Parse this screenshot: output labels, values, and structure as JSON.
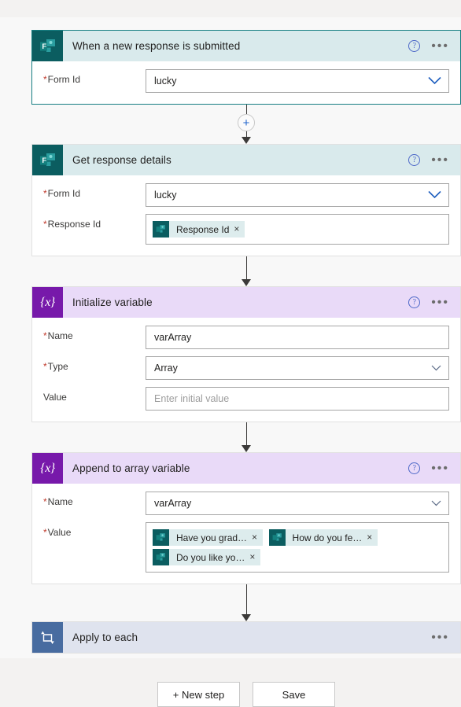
{
  "canvas": {
    "background_color": "#f8f8f8",
    "page_background_color": "#f3f2f1"
  },
  "colors": {
    "forms_icon": "#0b5d60",
    "forms_header": "#d9eaec",
    "variable_icon": "#7719aa",
    "variable_header": "#e9daf8",
    "loop_icon": "#486ca0",
    "loop_header": "#dfe3ee",
    "selected_border": "#167e82",
    "required_asterisk": "#c0392b",
    "link_blue": "#4d68c8",
    "token_chip": "#ddeced"
  },
  "steps": [
    {
      "id": "trigger",
      "title": "When a new response is submitted",
      "icon": "microsoft-forms-icon",
      "theme": "forms",
      "selected": true,
      "help_label": "?",
      "menu_label": "•••",
      "fields": [
        {
          "label": "Form Id",
          "required": true,
          "type": "dropdown",
          "value": "lucky",
          "placeholder": "",
          "chevron": "chevron-down-icon",
          "chevron_style": "blue"
        }
      ]
    },
    {
      "id": "get-response-details",
      "title": "Get response details",
      "icon": "microsoft-forms-icon",
      "theme": "forms",
      "selected": false,
      "help_label": "?",
      "menu_label": "•••",
      "fields": [
        {
          "label": "Form Id",
          "required": true,
          "type": "dropdown",
          "value": "lucky",
          "placeholder": "",
          "chevron": "chevron-down-icon",
          "chevron_style": "blue"
        },
        {
          "label": "Response Id",
          "required": true,
          "type": "tokens",
          "tokens": [
            {
              "text": "Response Id",
              "icon": "microsoft-forms-icon",
              "remove_label": "×"
            }
          ]
        }
      ]
    },
    {
      "id": "initialize-variable",
      "title": "Initialize variable",
      "icon": "variable-braces-icon",
      "theme": "varia",
      "selected": false,
      "help_label": "?",
      "menu_label": "•••",
      "fields": [
        {
          "label": "Name",
          "required": true,
          "type": "text",
          "value": "varArray",
          "placeholder": ""
        },
        {
          "label": "Type",
          "required": true,
          "type": "dropdown",
          "value": "Array",
          "placeholder": "",
          "chevron": "chevron-down-icon",
          "chevron_style": "gray"
        },
        {
          "label": "Value",
          "required": false,
          "type": "text",
          "value": "",
          "placeholder": "Enter initial value"
        }
      ]
    },
    {
      "id": "append-to-array-variable",
      "title": "Append to array variable",
      "icon": "variable-braces-icon",
      "theme": "varia",
      "selected": false,
      "help_label": "?",
      "menu_label": "•••",
      "fields": [
        {
          "label": "Name",
          "required": true,
          "type": "dropdown",
          "value": "varArray",
          "placeholder": "",
          "chevron": "chevron-down-icon",
          "chevron_style": "gray"
        },
        {
          "label": "Value",
          "required": true,
          "type": "tokens",
          "tokens": [
            {
              "text": "Have you grad…",
              "icon": "microsoft-forms-icon",
              "remove_label": "×"
            },
            {
              "text": "How do you fe…",
              "icon": "microsoft-forms-icon",
              "remove_label": "×"
            },
            {
              "text": "Do you like yo…",
              "icon": "microsoft-forms-icon",
              "remove_label": "×"
            }
          ]
        }
      ]
    },
    {
      "id": "apply-to-each",
      "title": "Apply to each",
      "icon": "loop-foreach-icon",
      "theme": "loop",
      "selected": false,
      "collapsed": true,
      "help_label": "",
      "menu_label": "•••",
      "fields": []
    }
  ],
  "connectors": [
    {
      "after": "trigger",
      "has_plus_button": true,
      "plus_label": "+"
    },
    {
      "after": "get-response-details",
      "has_plus_button": false
    },
    {
      "after": "initialize-variable",
      "has_plus_button": false
    },
    {
      "after": "append-to-array-variable",
      "has_plus_button": false
    }
  ],
  "footer": {
    "new_step_label": "+ New step",
    "save_label": "Save"
  }
}
